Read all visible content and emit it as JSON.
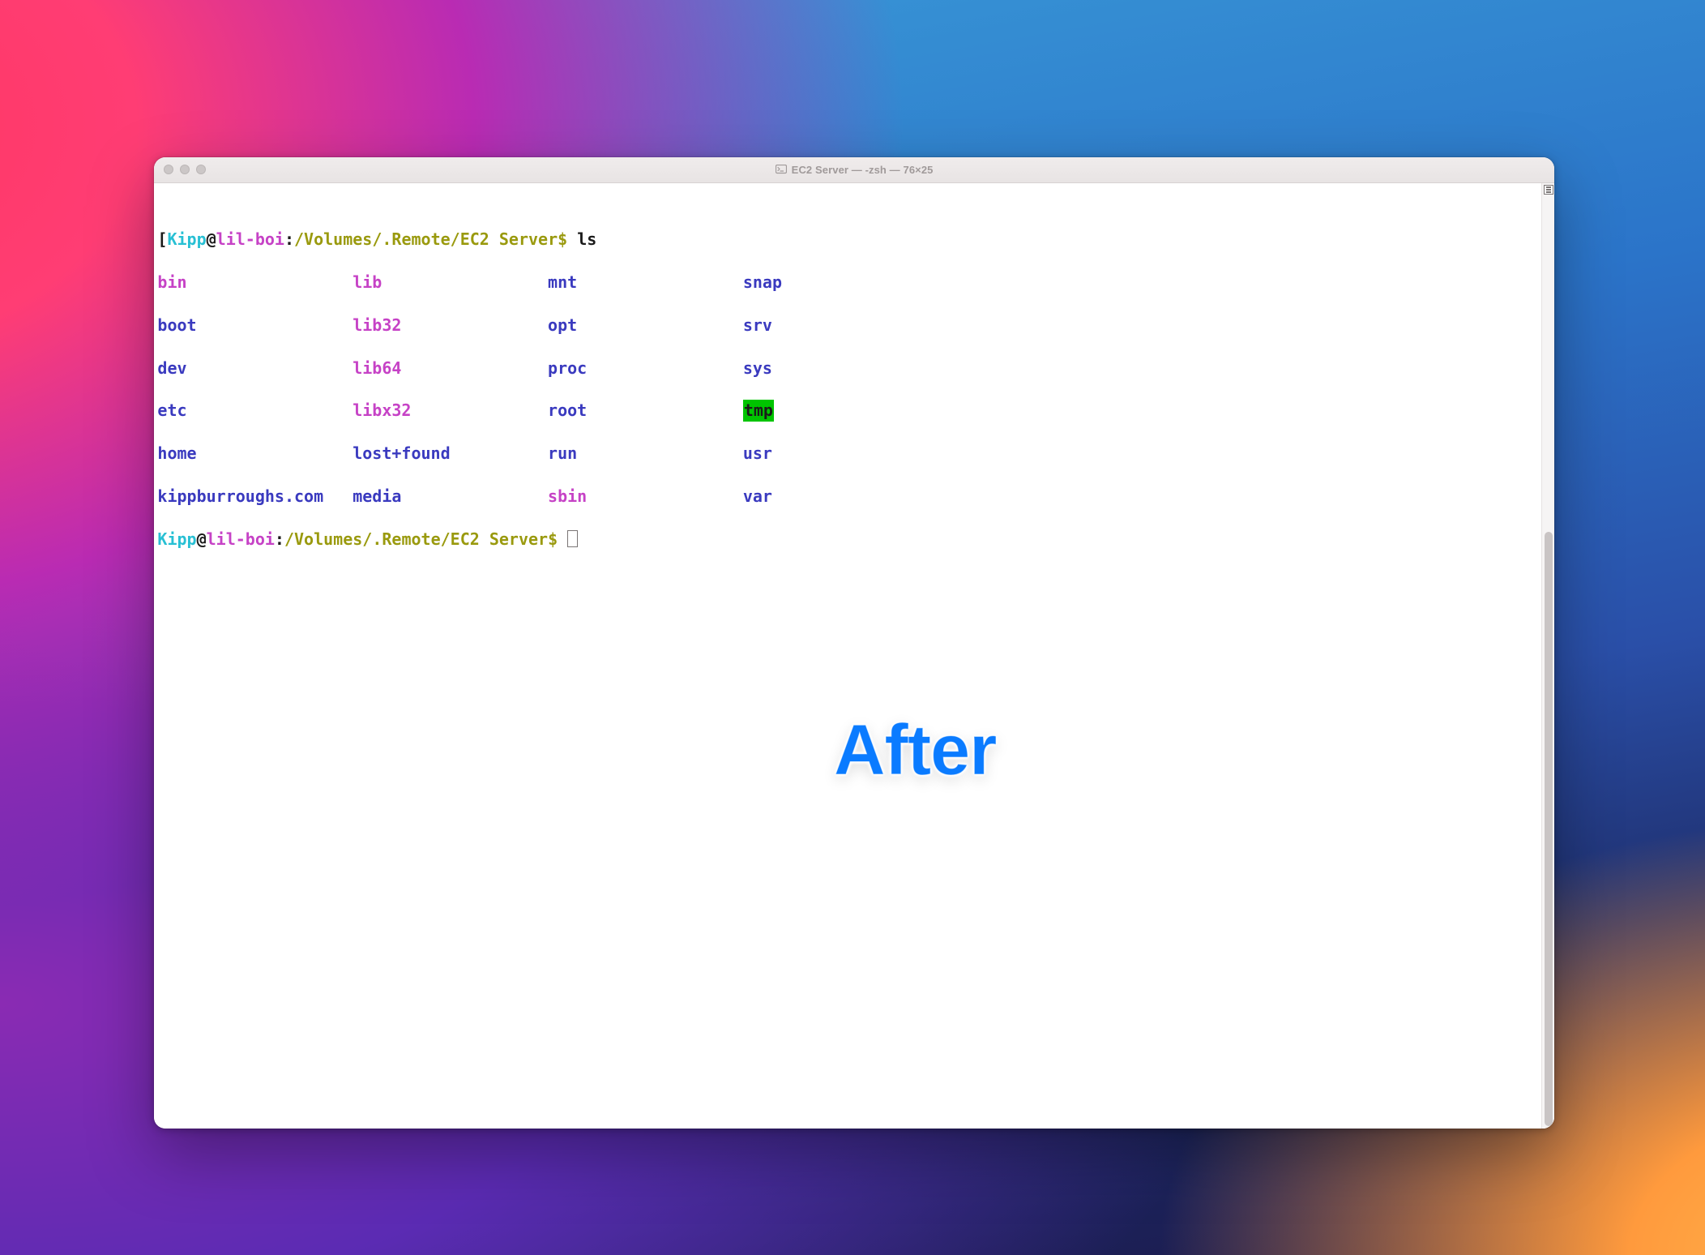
{
  "window": {
    "title": "EC2 Server — -zsh — 76×25"
  },
  "prompt": {
    "open_bracket": "[",
    "user": "Kipp",
    "at": "@",
    "host": "lil-boi",
    "sep": ":",
    "path": "/Volumes/.Remote/EC2 Server",
    "sigil": "$ "
  },
  "command": "ls",
  "listing": {
    "rows": [
      [
        {
          "text": "bin",
          "style": "c-magenta"
        },
        {
          "text": "lib",
          "style": "c-magenta"
        },
        {
          "text": "mnt",
          "style": "c-blue"
        },
        {
          "text": "snap",
          "style": "c-blue"
        }
      ],
      [
        {
          "text": "boot",
          "style": "c-blue"
        },
        {
          "text": "lib32",
          "style": "c-magenta"
        },
        {
          "text": "opt",
          "style": "c-blue"
        },
        {
          "text": "srv",
          "style": "c-blue"
        }
      ],
      [
        {
          "text": "dev",
          "style": "c-blue"
        },
        {
          "text": "lib64",
          "style": "c-magenta"
        },
        {
          "text": "proc",
          "style": "c-blue"
        },
        {
          "text": "sys",
          "style": "c-blue"
        }
      ],
      [
        {
          "text": "etc",
          "style": "c-blue"
        },
        {
          "text": "libx32",
          "style": "c-magenta"
        },
        {
          "text": "root",
          "style": "c-blue"
        },
        {
          "text": "tmp",
          "style": "c-green-hl"
        }
      ],
      [
        {
          "text": "home",
          "style": "c-blue"
        },
        {
          "text": "lost+found",
          "style": "c-blue"
        },
        {
          "text": "run",
          "style": "c-blue"
        },
        {
          "text": "usr",
          "style": "c-blue"
        }
      ],
      [
        {
          "text": "kippburroughs.com",
          "style": "c-blue"
        },
        {
          "text": "media",
          "style": "c-blue"
        },
        {
          "text": "sbin",
          "style": "c-magenta"
        },
        {
          "text": "var",
          "style": "c-blue"
        }
      ]
    ]
  },
  "overlay_label": "After"
}
